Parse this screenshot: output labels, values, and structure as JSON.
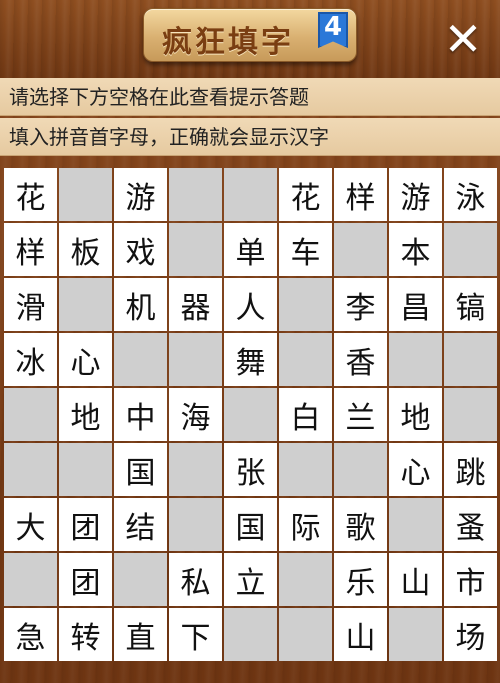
{
  "header": {
    "title": "疯狂填字",
    "level": "4",
    "close_label": "✕"
  },
  "hints": {
    "line1": "请选择下方空格在此查看提示答题",
    "line2": "填入拼音首字母，正确就会显示汉字"
  },
  "grid": {
    "rows": [
      [
        "花",
        null,
        "游",
        null,
        null,
        "花",
        "样",
        "游",
        "泳"
      ],
      [
        "样",
        "板",
        "戏",
        null,
        "单",
        "车",
        null,
        "本",
        null
      ],
      [
        "滑",
        null,
        "机",
        "器",
        "人",
        null,
        "李",
        "昌",
        "镐"
      ],
      [
        "冰",
        "心",
        null,
        null,
        "舞",
        null,
        "香",
        null,
        null
      ],
      [
        null,
        "地",
        "中",
        "海",
        null,
        "白",
        "兰",
        "地",
        null
      ],
      [
        null,
        null,
        "国",
        null,
        "张",
        null,
        null,
        "心",
        "跳"
      ],
      [
        "大",
        "团",
        "结",
        null,
        "国",
        "际",
        "歌",
        null,
        "蚤"
      ],
      [
        null,
        "团",
        null,
        "私",
        "立",
        null,
        "乐",
        "山",
        "市"
      ],
      [
        "急",
        "转",
        "直",
        "下",
        null,
        null,
        "山",
        null,
        "场"
      ]
    ],
    "white_cells": [
      [
        1,
        0,
        1,
        0,
        0,
        1,
        1,
        1,
        1
      ],
      [
        1,
        1,
        1,
        0,
        1,
        1,
        0,
        1,
        0
      ],
      [
        1,
        0,
        1,
        1,
        1,
        0,
        1,
        1,
        1
      ],
      [
        1,
        1,
        0,
        0,
        1,
        0,
        1,
        0,
        0
      ],
      [
        0,
        1,
        1,
        1,
        0,
        1,
        1,
        1,
        0
      ],
      [
        0,
        0,
        1,
        0,
        1,
        0,
        0,
        1,
        1
      ],
      [
        1,
        1,
        1,
        0,
        1,
        1,
        1,
        0,
        1
      ],
      [
        0,
        1,
        0,
        1,
        1,
        0,
        1,
        1,
        1
      ],
      [
        1,
        1,
        1,
        1,
        0,
        0,
        1,
        0,
        1
      ]
    ]
  }
}
